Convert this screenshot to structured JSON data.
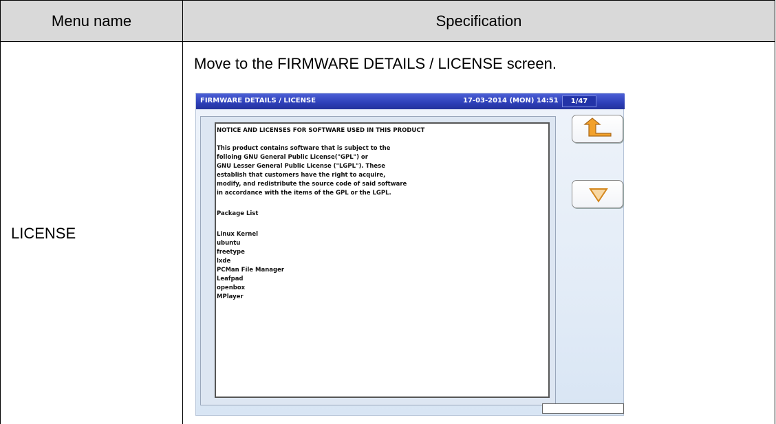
{
  "table": {
    "header_menu": "Menu name",
    "header_spec": "Specification",
    "menu_name": "LICENSE",
    "spec_text": "Move to the FIRMWARE DETAILS / LICENSE screen."
  },
  "device": {
    "title": "FIRMWARE DETAILS / LICENSE",
    "datetime": "17-03-2014 (MON) 14:51",
    "page": "1/47",
    "license_lines": [
      "NOTICE AND LICENSES FOR SOFTWARE USED IN THIS PRODUCT",
      "This product contains software that is subject to the",
      "folloing GNU General Public License(\"GPL\") or",
      "GNU Lesser General Public License (\"LGPL\"). These",
      "establish that customers have the right to acquire,",
      "modify, and redistribute the source code of said software",
      "in accordance with the items of the GPL or the LGPL.",
      "Package List",
      "Linux Kernel",
      "ubuntu",
      "freetype",
      "lxde",
      "PCMan File Manager",
      "Leafpad",
      "openbox",
      "MPlayer"
    ],
    "buttons": {
      "back_icon": "return-arrow-icon",
      "down_icon": "triangle-down-icon"
    },
    "colors": {
      "title_bar": "#2d3fb8",
      "arrow": "#f2a12b"
    }
  }
}
